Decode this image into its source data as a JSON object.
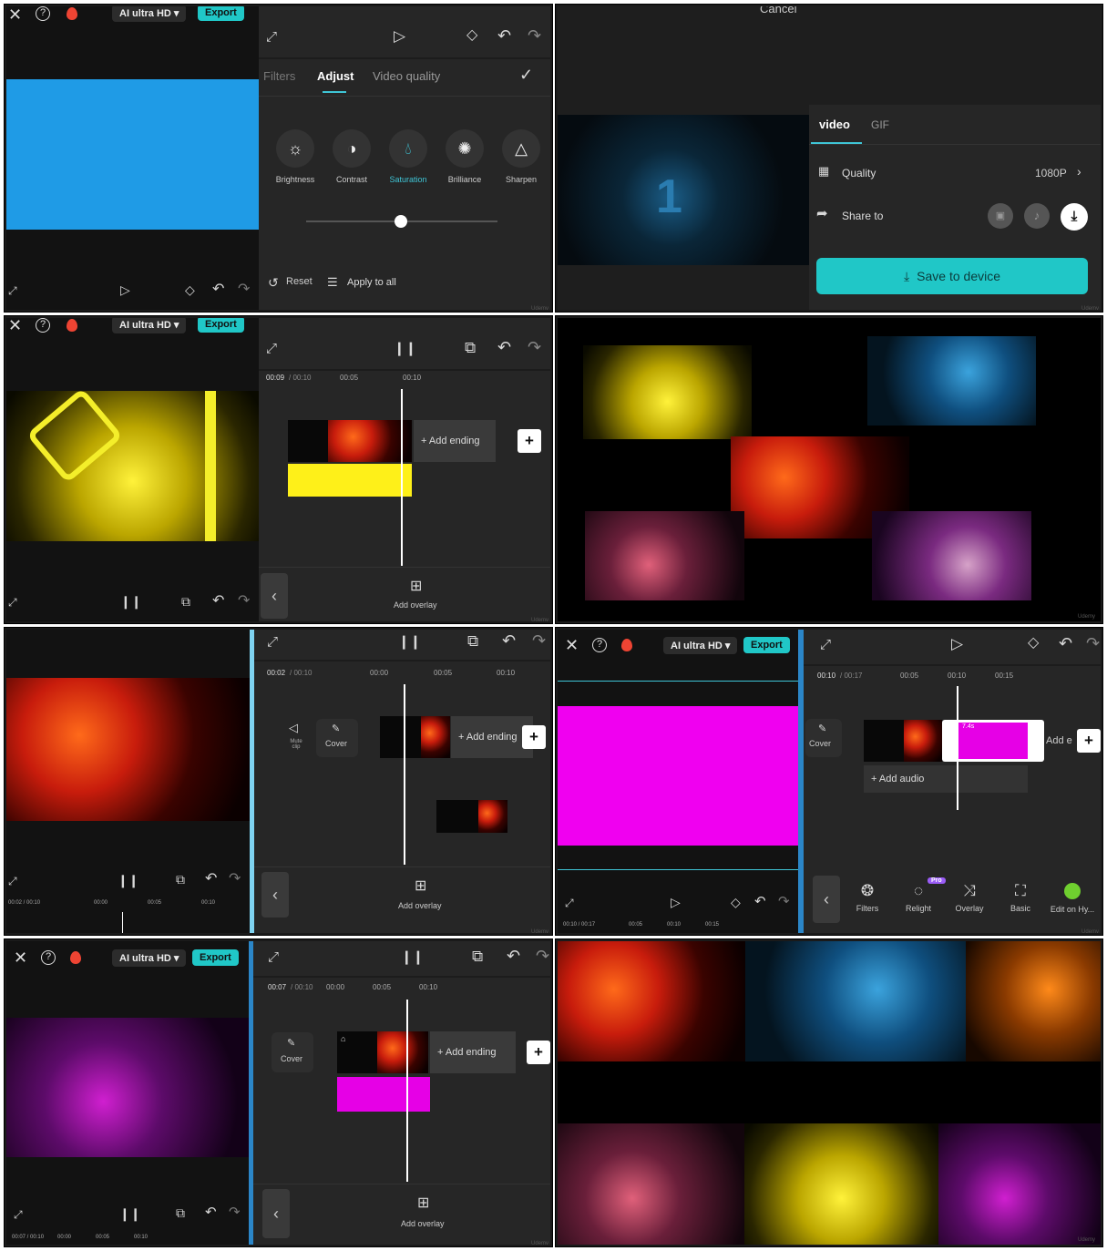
{
  "p1": {
    "ai_hd": "AI ultra HD ▾",
    "export": "Export",
    "tabs": [
      "Filters",
      "Adjust",
      "Video quality"
    ],
    "tools": [
      "Brightness",
      "Contrast",
      "Saturation",
      "Brilliance",
      "Sharpen"
    ],
    "reset": "Reset",
    "apply_all": "Apply to all",
    "slider_value": 0.5,
    "colors": {
      "preview": "#1f9be6",
      "accent": "#3fc5d6"
    },
    "watermark": "Udemy"
  },
  "p2": {
    "cancel": "Cancel",
    "tabs": [
      "video",
      "GIF"
    ],
    "quality_label": "Quality",
    "quality_value": "1080P",
    "share_label": "Share to",
    "save_btn": "Save to device",
    "watermark": "Udemy"
  },
  "p3": {
    "ai_hd": "AI ultra HD ▾",
    "export": "Export",
    "time_current": "00:09",
    "time_total": "00:10",
    "ticks": [
      "00:05",
      "00:10"
    ],
    "add_ending": "+ Add ending",
    "add_overlay": "Add overlay",
    "watermark": "Udemy"
  },
  "p5": {
    "time_current": "00:02",
    "time_total": "00:10",
    "ticks": [
      "00:00",
      "00:05",
      "00:10"
    ],
    "mute": "Mute clip",
    "cover": "Cover",
    "add_ending": "+ Add ending",
    "add_overlay": "Add overlay",
    "bottom_time": "00:02 / 00:10",
    "bottom_ticks": [
      "00:00",
      "00:05",
      "00:10"
    ],
    "watermark": "Udemy"
  },
  "p6": {
    "ai_hd": "AI ultra HD ▾",
    "export": "Export",
    "time_current": "00:10",
    "time_total": "00:17",
    "ticks": [
      "00:05",
      "00:10",
      "00:15"
    ],
    "cover": "Cover",
    "clip_badge": "7.4s",
    "add_ending": "Add e",
    "add_audio": "+ Add audio",
    "tools": [
      "Filters",
      "Relight",
      "Overlay",
      "Basic",
      "Edit on Hy..."
    ],
    "pro": "Pro",
    "bottom_time": "00:10 / 00:17",
    "bottom_ticks": [
      "00:05",
      "00:10",
      "00:15"
    ],
    "colors": {
      "preview": "#f000f0"
    },
    "watermark": "Udemy"
  },
  "p7": {
    "ai_hd": "AI ultra HD ▾",
    "export": "Export",
    "time_current": "00:07",
    "time_total": "00:10",
    "ticks": [
      "00:00",
      "00:05",
      "00:10"
    ],
    "cover": "Cover",
    "add_ending": "+ Add ending",
    "add_overlay": "Add overlay",
    "bottom_time": "00:07 / 00:10",
    "bottom_ticks": [
      "00:00",
      "00:05",
      "00:10"
    ],
    "watermark": "Udemy"
  },
  "p4_watermark": "Udemy",
  "p8_watermark": "Udemy"
}
